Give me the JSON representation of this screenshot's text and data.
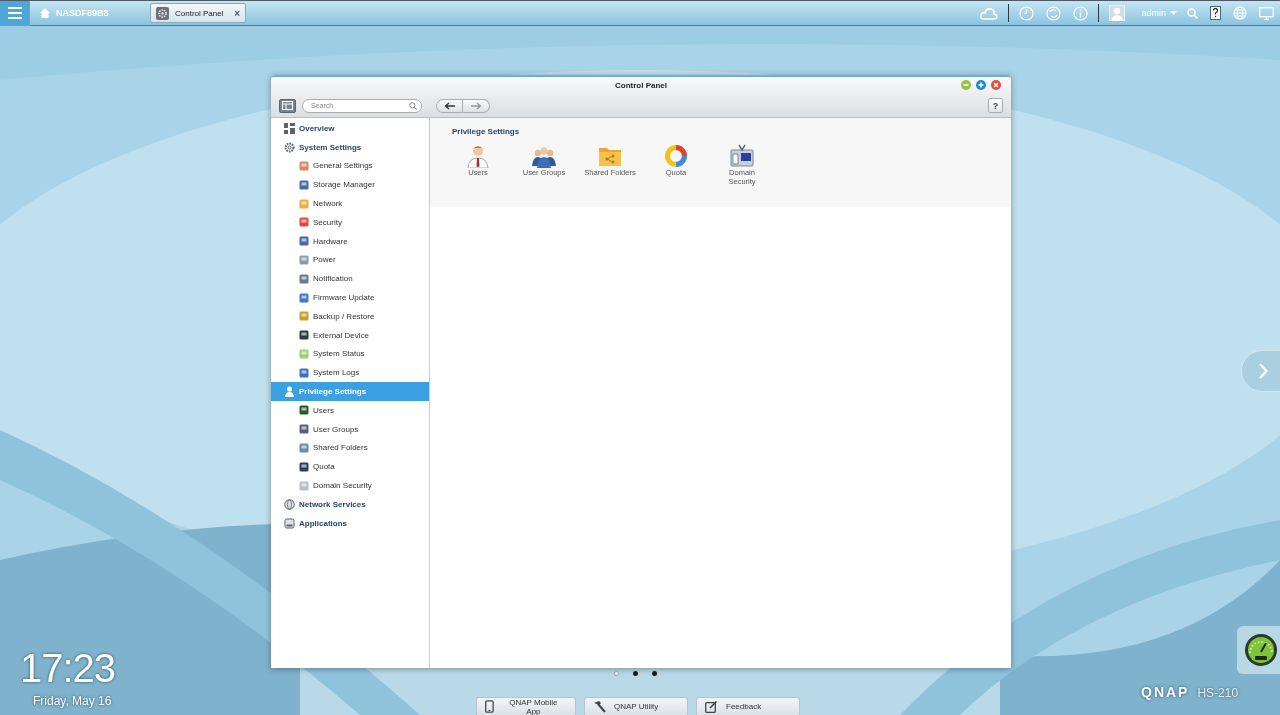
{
  "taskbar": {
    "home_label": "NASDF89B8",
    "tabs": [
      {
        "label": "Control Panel",
        "close": "×",
        "selected": true
      }
    ],
    "user": "admin"
  },
  "window": {
    "title": "Control Panel",
    "search": {
      "placeholder": "Search"
    },
    "help": "?"
  },
  "sidebar": {
    "items": [
      {
        "label": "Overview",
        "selected": false
      },
      {
        "label": "System Settings",
        "selected": false,
        "children": [
          {
            "label": "General Settings",
            "selected": false
          },
          {
            "label": "Storage Manager",
            "selected": false
          },
          {
            "label": "Network",
            "selected": false
          },
          {
            "label": "Security",
            "selected": false
          },
          {
            "label": "Hardware",
            "selected": false
          },
          {
            "label": "Power",
            "selected": false
          },
          {
            "label": "Notification",
            "selected": false
          },
          {
            "label": "Firmware Update",
            "selected": false
          },
          {
            "label": "Backup / Restore",
            "selected": false
          },
          {
            "label": "External Device",
            "selected": false
          },
          {
            "label": "System Status",
            "selected": false
          },
          {
            "label": "System Logs",
            "selected": false
          }
        ]
      },
      {
        "label": "Privilege Settings",
        "selected": true,
        "children": [
          {
            "label": "Users",
            "selected": false
          },
          {
            "label": "User Groups",
            "selected": false
          },
          {
            "label": "Shared Folders",
            "selected": false
          },
          {
            "label": "Quota",
            "selected": false
          },
          {
            "label": "Domain Security",
            "selected": false
          }
        ]
      },
      {
        "label": "Network Services",
        "selected": false
      },
      {
        "label": "Applications",
        "selected": false
      }
    ]
  },
  "content": {
    "heading": "Privilege Settings",
    "tiles": [
      {
        "label": "Users"
      },
      {
        "label": "User Groups"
      },
      {
        "label": "Shared Folders"
      },
      {
        "label": "Quota"
      },
      {
        "label": "Domain Security"
      }
    ]
  },
  "pager": [
    {
      "selected": true
    },
    {
      "selected": false
    },
    {
      "selected": false
    }
  ],
  "clock": {
    "time": "17:23",
    "date": "Friday, May 16"
  },
  "dock": [
    {
      "label": "QNAP Mobile App"
    },
    {
      "label": "QNAP Utility"
    },
    {
      "label": "Feedback"
    }
  ],
  "brand": {
    "logo": "QNAP",
    "model": "HS-210"
  }
}
